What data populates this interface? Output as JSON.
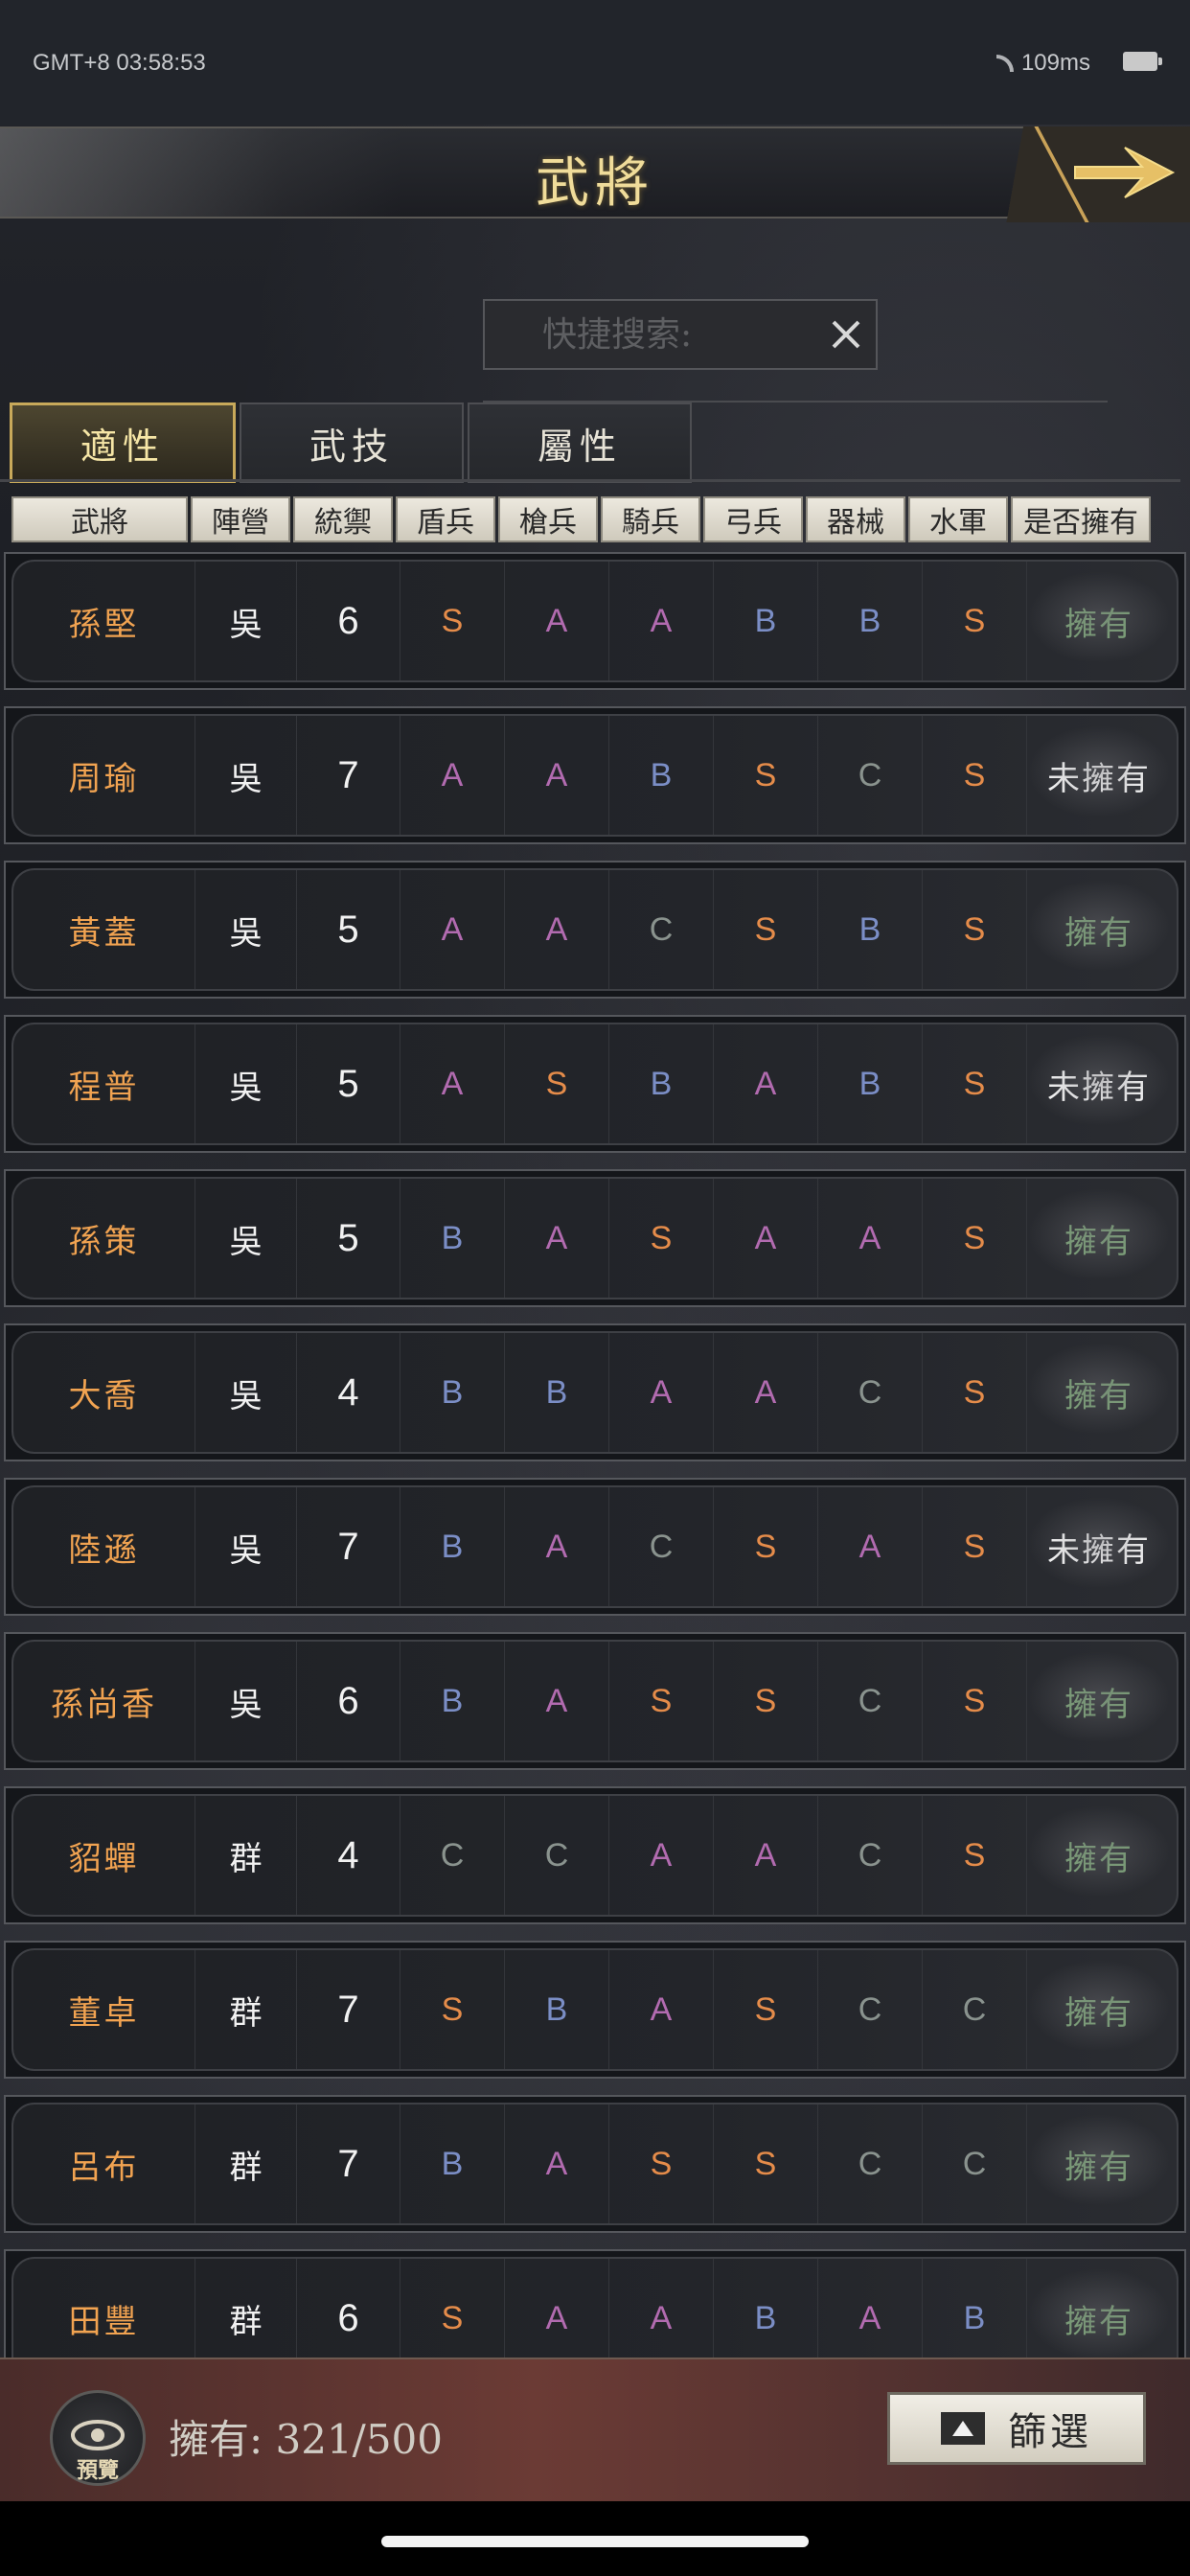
{
  "status_bar": {
    "time": "GMT+8 03:58:53",
    "latency": "109ms"
  },
  "title": "武將",
  "search": {
    "placeholder": "快捷搜索:"
  },
  "tabs": [
    "適性",
    "武技",
    "屬性"
  ],
  "columns": [
    "武將",
    "陣營",
    "統禦",
    "盾兵",
    "槍兵",
    "騎兵",
    "弓兵",
    "器械",
    "水軍",
    "是否擁有"
  ],
  "rows": [
    {
      "name": "孫堅",
      "faction": "吳",
      "command": "6",
      "grades": [
        "S",
        "A",
        "A",
        "B",
        "B",
        "S"
      ],
      "owned": "擁有",
      "is_owned": true
    },
    {
      "name": "周瑜",
      "faction": "吳",
      "command": "7",
      "grades": [
        "A",
        "A",
        "B",
        "S",
        "C",
        "S"
      ],
      "owned": "未擁有",
      "is_owned": false
    },
    {
      "name": "黃蓋",
      "faction": "吳",
      "command": "5",
      "grades": [
        "A",
        "A",
        "C",
        "S",
        "B",
        "S"
      ],
      "owned": "擁有",
      "is_owned": true
    },
    {
      "name": "程普",
      "faction": "吳",
      "command": "5",
      "grades": [
        "A",
        "S",
        "B",
        "A",
        "B",
        "S"
      ],
      "owned": "未擁有",
      "is_owned": false
    },
    {
      "name": "孫策",
      "faction": "吳",
      "command": "5",
      "grades": [
        "B",
        "A",
        "S",
        "A",
        "A",
        "S"
      ],
      "owned": "擁有",
      "is_owned": true
    },
    {
      "name": "大喬",
      "faction": "吳",
      "command": "4",
      "grades": [
        "B",
        "B",
        "A",
        "A",
        "C",
        "S"
      ],
      "owned": "擁有",
      "is_owned": true
    },
    {
      "name": "陸遜",
      "faction": "吳",
      "command": "7",
      "grades": [
        "B",
        "A",
        "C",
        "S",
        "A",
        "S"
      ],
      "owned": "未擁有",
      "is_owned": false
    },
    {
      "name": "孫尚香",
      "faction": "吳",
      "command": "6",
      "grades": [
        "B",
        "A",
        "S",
        "S",
        "C",
        "S"
      ],
      "owned": "擁有",
      "is_owned": true
    },
    {
      "name": "貂蟬",
      "faction": "群",
      "command": "4",
      "grades": [
        "C",
        "C",
        "A",
        "A",
        "C",
        "S"
      ],
      "owned": "擁有",
      "is_owned": true
    },
    {
      "name": "董卓",
      "faction": "群",
      "command": "7",
      "grades": [
        "S",
        "B",
        "A",
        "S",
        "C",
        "C"
      ],
      "owned": "擁有",
      "is_owned": true
    },
    {
      "name": "呂布",
      "faction": "群",
      "command": "7",
      "grades": [
        "B",
        "A",
        "S",
        "S",
        "C",
        "C"
      ],
      "owned": "擁有",
      "is_owned": true
    },
    {
      "name": "田豐",
      "faction": "群",
      "command": "6",
      "grades": [
        "S",
        "A",
        "A",
        "B",
        "A",
        "B"
      ],
      "owned": "擁有",
      "is_owned": true
    }
  ],
  "grade_colors": {
    "S": "#e58c4a",
    "A": "#b26bb0",
    "B": "#7b8ec6",
    "C": "#8a938e"
  },
  "footer": {
    "preview_label": "預覽",
    "owned_count": "擁有: 321/500",
    "filter_label": "篩選"
  }
}
